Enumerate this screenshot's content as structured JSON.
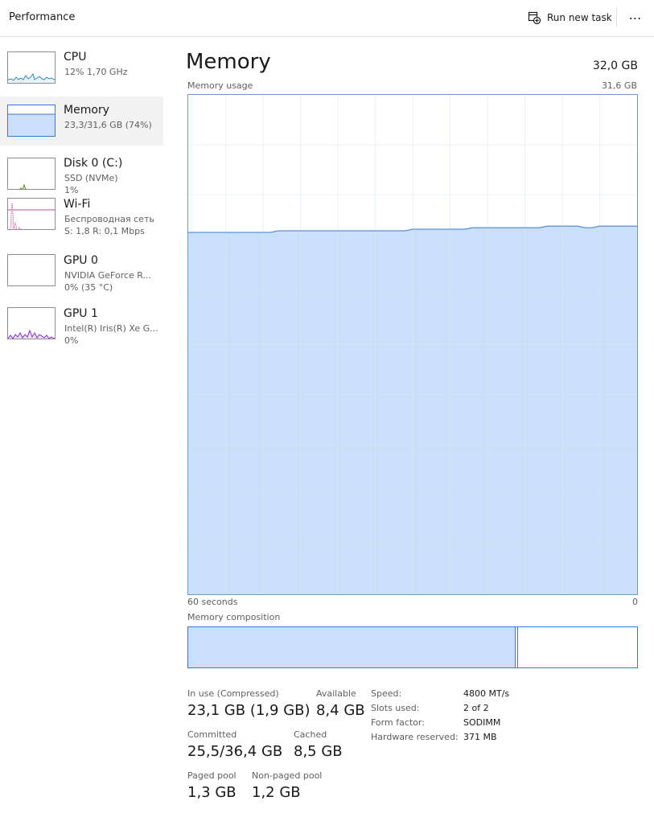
{
  "header": {
    "title": "Performance",
    "run_task_label": "Run new task",
    "more_label": "⋯"
  },
  "sidebar": {
    "items": [
      {
        "name": "CPU",
        "sub1": "12%  1,70 GHz",
        "sub2": "",
        "color": "#2a8bbd",
        "fill": "#e8f4fa"
      },
      {
        "name": "Memory",
        "sub1": "23,3/31,6 GB (74%)",
        "sub2": "",
        "color": "#3b78d0",
        "fill": "#c9dffa"
      },
      {
        "name": "Disk 0 (C:)",
        "sub1": "SSD (NVMe)",
        "sub2": "1%",
        "color": "#4f9a1b",
        "fill": "#e6f3d9"
      },
      {
        "name": "Wi-Fi",
        "sub1": "Беспроводная сеть",
        "sub2": "S: 1,8  R: 0,1 Mbps",
        "color": "#a3156b",
        "fill": "#f7e3ee"
      },
      {
        "name": "GPU 0",
        "sub1": "NVIDIA GeForce R...",
        "sub2": "0%  (35 °C)",
        "color": "#7b2ec9",
        "fill": "#efe3fa"
      },
      {
        "name": "GPU 1",
        "sub1": "Intel(R) Iris(R) Xe G...",
        "sub2": "0%",
        "color": "#7b2ec9",
        "fill": "#efe3fa"
      }
    ]
  },
  "main": {
    "title": "Memory",
    "total": "32,0 GB",
    "usage_label": "Memory usage",
    "usage_max": "31,6 GB",
    "axis_left": "60 seconds",
    "axis_right": "0",
    "composition_label": "Memory composition"
  },
  "stats": {
    "in_use_label": "In use (Compressed)",
    "in_use_value": "23,1 GB (1,9 GB)",
    "available_label": "Available",
    "available_value": "8,4 GB",
    "committed_label": "Committed",
    "committed_value": "25,5/36,4 GB",
    "cached_label": "Cached",
    "cached_value": "8,5 GB",
    "paged_label": "Paged pool",
    "paged_value": "1,3 GB",
    "nonpaged_label": "Non-paged pool",
    "nonpaged_value": "1,2 GB"
  },
  "specs": {
    "speed_label": "Speed:",
    "speed_value": "4800 MT/s",
    "slots_label": "Slots used:",
    "slots_value": "2 of 2",
    "form_label": "Form factor:",
    "form_value": "SODIMM",
    "reserved_label": "Hardware reserved:",
    "reserved_value": "371 MB"
  },
  "colors": {
    "memory_line": "#3b78d0",
    "memory_fill": "#c9dffa",
    "grid": "#dde8f4"
  },
  "chart_data": {
    "type": "area",
    "title": "",
    "xlabel": "",
    "ylabel": "",
    "xlim": [
      60,
      0
    ],
    "ylim": [
      0,
      31.6
    ],
    "grid": true,
    "series": [
      {
        "values": [
          22.9,
          22.9,
          22.9,
          22.9,
          22.9,
          22.9,
          22.9,
          22.9,
          22.9,
          22.9,
          22.9,
          22.9,
          23.0,
          23.0,
          23.0,
          23.0,
          23.0,
          23.0,
          23.0,
          23.0,
          23.0,
          23.0,
          23.0,
          23.0,
          23.0,
          23.0,
          23.0,
          23.0,
          23.0,
          23.0,
          23.1,
          23.1,
          23.1,
          23.1,
          23.1,
          23.1,
          23.1,
          23.1,
          23.2,
          23.2,
          23.2,
          23.2,
          23.2,
          23.2,
          23.2,
          23.2,
          23.2,
          23.2,
          23.3,
          23.3,
          23.3,
          23.3,
          23.3,
          23.2,
          23.2,
          23.3,
          23.3,
          23.3,
          23.3,
          23.3,
          23.3
        ]
      }
    ],
    "composition": {
      "in_use_fraction": 0.73,
      "modified_fraction": 0.006
    }
  }
}
